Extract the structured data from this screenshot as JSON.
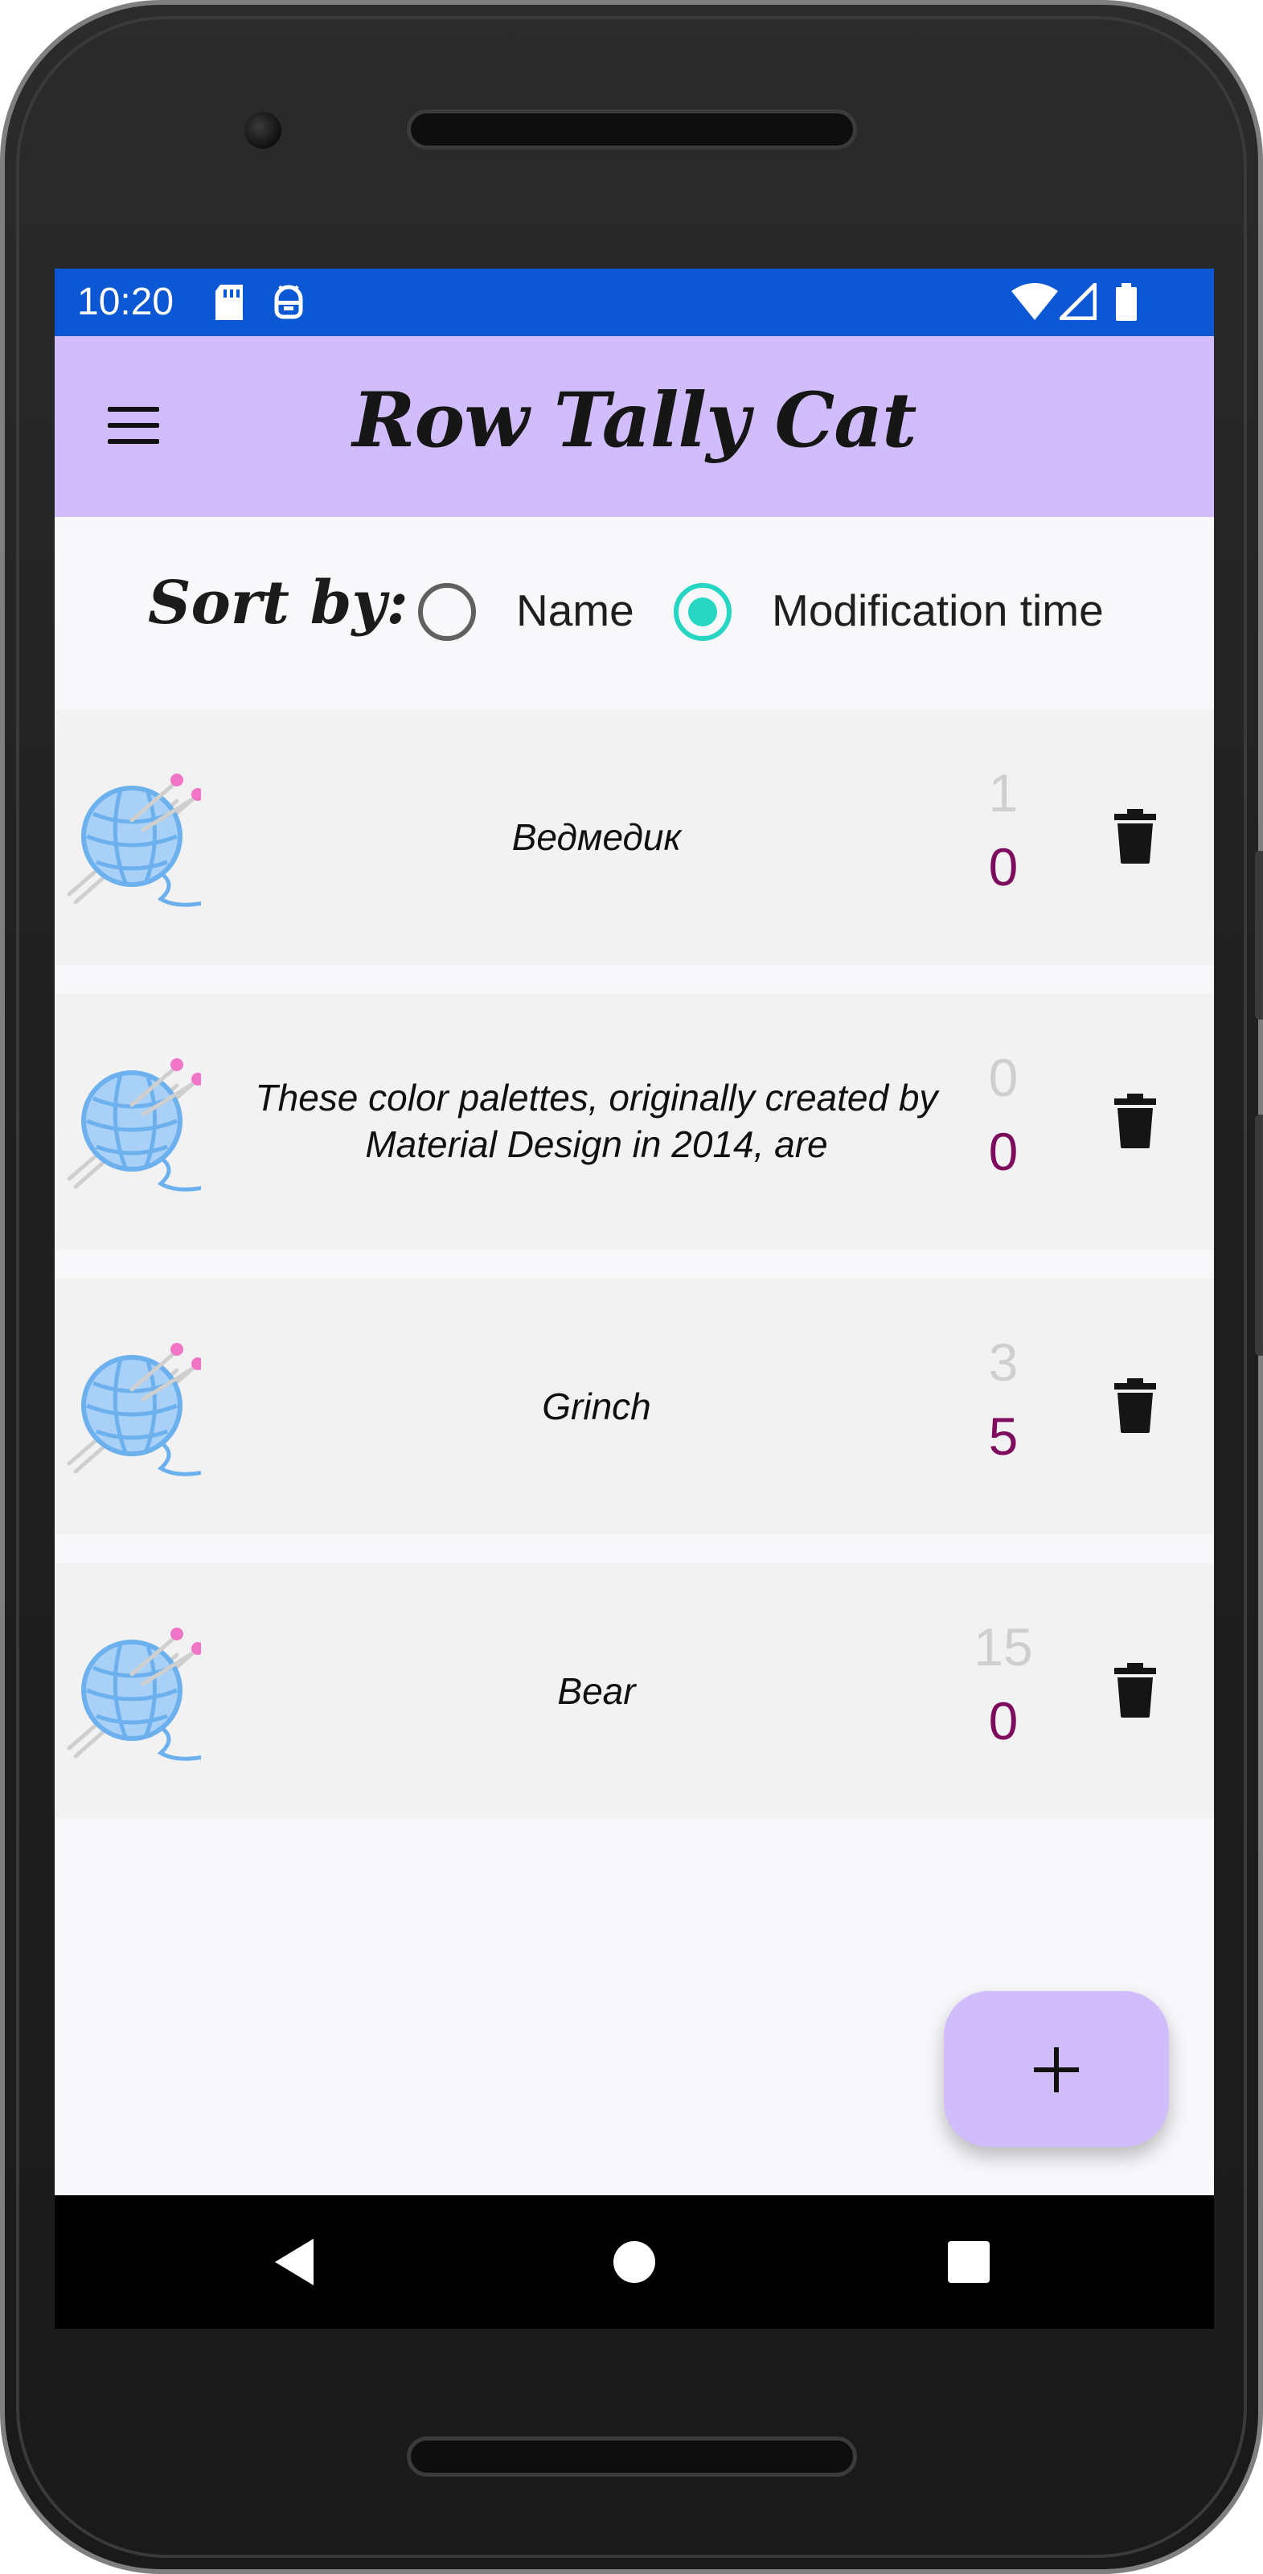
{
  "status_bar": {
    "time": "10:20",
    "icons": [
      "sd-card-icon",
      "android-debug-icon",
      "wifi-icon",
      "cell-signal-icon",
      "battery-icon"
    ],
    "background": "#0c57d3"
  },
  "app_bar": {
    "title": "Row Tally Cat",
    "menu_icon": "hamburger-menu-icon",
    "background": "#d1bdfb"
  },
  "sort": {
    "label": "Sort by:",
    "options": [
      {
        "label": "Name",
        "selected": false
      },
      {
        "label": "Modification time",
        "selected": true
      }
    ],
    "accent": "#26d6c3"
  },
  "projects": [
    {
      "name": "Ведмедик",
      "count_top": "1",
      "count_bottom": "0"
    },
    {
      "name": "These color palettes, originally created by Material Design in 2014, are",
      "count_top": "0",
      "count_bottom": "0"
    },
    {
      "name": "Grinch",
      "count_top": "3",
      "count_bottom": "5"
    },
    {
      "name": "Bear",
      "count_top": "15",
      "count_bottom": "0"
    }
  ],
  "colors": {
    "count_top": "#cfcfcf",
    "count_bottom": "#7d0b5e",
    "row_background": "#f2f2f2"
  },
  "fab": {
    "icon": "plus-icon"
  },
  "nav_bar": {
    "icons": [
      "back-icon",
      "home-icon",
      "recents-icon"
    ]
  }
}
